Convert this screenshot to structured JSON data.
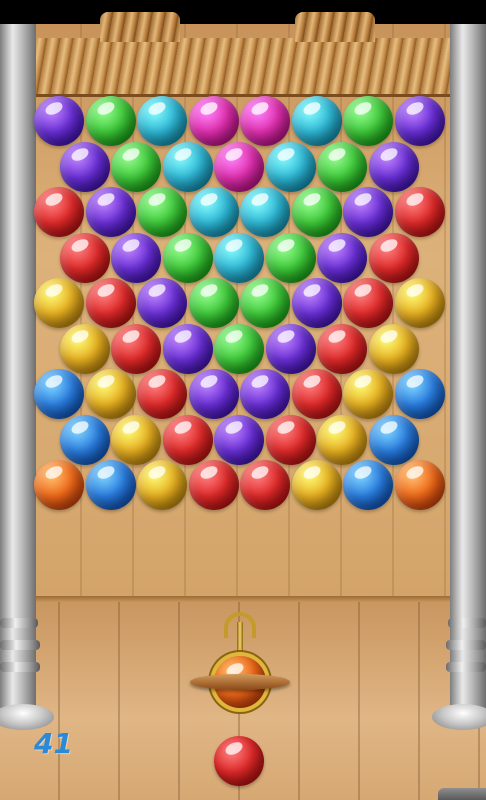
{
  "game": {
    "shots_remaining": "41"
  },
  "colors": {
    "purple": "#6a2fd6",
    "green": "#3fc93a",
    "cyan": "#2fb8d6",
    "magenta": "#e02fae",
    "red": "#e02a2a",
    "yellow": "#e7b021",
    "blue": "#2a7ee0",
    "orange": "#f06a1a",
    "counter_text": "#2a8ad8"
  },
  "grid": {
    "rows": [
      [
        "purple",
        "green",
        "cyan",
        "magenta",
        "magenta",
        "cyan",
        "green",
        "purple"
      ],
      [
        "purple",
        "green",
        "cyan",
        "magenta",
        "cyan",
        "green",
        "purple"
      ],
      [
        "red",
        "purple",
        "green",
        "cyan",
        "cyan",
        "green",
        "purple",
        "red"
      ],
      [
        "red",
        "purple",
        "green",
        "cyan",
        "green",
        "purple",
        "red"
      ],
      [
        "yellow",
        "red",
        "purple",
        "green",
        "green",
        "purple",
        "red",
        "yellow"
      ],
      [
        "yellow",
        "red",
        "purple",
        "green",
        "purple",
        "red",
        "yellow"
      ],
      [
        "blue",
        "yellow",
        "red",
        "purple",
        "purple",
        "red",
        "yellow",
        "blue"
      ],
      [
        "blue",
        "yellow",
        "red",
        "purple",
        "red",
        "yellow",
        "blue"
      ],
      [
        "orange",
        "blue",
        "yellow",
        "red",
        "red",
        "yellow",
        "blue",
        "orange"
      ]
    ]
  },
  "launcher": {
    "current_bubble": "orange",
    "next_bubble": "red"
  }
}
